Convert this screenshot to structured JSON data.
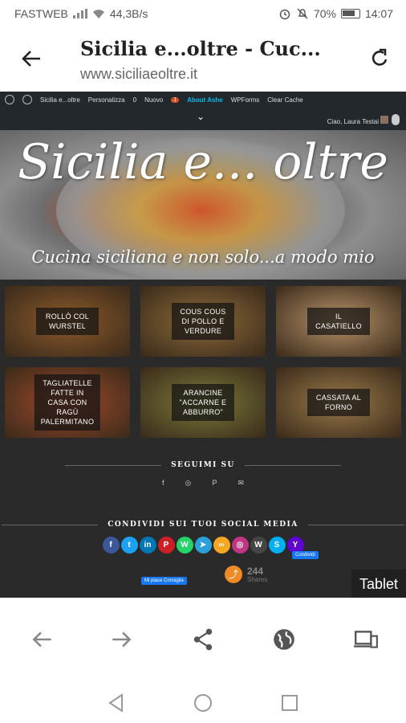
{
  "status_bar": {
    "carrier": "FASTWEB",
    "speed": "44,3B/s",
    "battery": "70%",
    "time": "14:07"
  },
  "browser": {
    "title": "Sicilia e...oltre - Cuc...",
    "url": "www.siciliaeoltre.it"
  },
  "admin_bar": {
    "items": [
      "Sicilia e...oltre",
      "Personalizza",
      "0",
      "Nuovo",
      "1",
      "About Ashe",
      "WPForms",
      "Clear Cache"
    ],
    "greeting": "Ciao, Laura Testai"
  },
  "hero": {
    "title": "Sicilia e... oltre",
    "tagline": "Cucina siciliana e non solo...a modo mio"
  },
  "cards": [
    {
      "label": "ROLLÒ COL WURSTEL",
      "color": "#8b5a2b"
    },
    {
      "label": "COUS COUS DI POLLO E VERDURE",
      "color": "#8c6a3a"
    },
    {
      "label": "IL CASATIELLO",
      "color": "#b8946a"
    },
    {
      "label": "TAGLIATELLE FATTE IN CASA CON RAGÙ PALERMITANO",
      "color": "#a04a2a"
    },
    {
      "label": "ARANCINE \"ACCARNE E ABBURRO\"",
      "color": "#7a7a3a"
    },
    {
      "label": "CASSATA AL FORNO",
      "color": "#9a7a4a"
    }
  ],
  "follow": {
    "title": "SEGUIMI SU",
    "icons": [
      "f",
      "◎",
      "P",
      "✉"
    ]
  },
  "share": {
    "title": "CONDIVIDI SUI TUOI SOCIAL MEDIA",
    "buttons": [
      {
        "glyph": "f",
        "color": "#3b5998"
      },
      {
        "glyph": "t",
        "color": "#1da1f2"
      },
      {
        "glyph": "in",
        "color": "#0077b5"
      },
      {
        "glyph": "P",
        "color": "#cb2027"
      },
      {
        "glyph": "W",
        "color": "#25d366"
      },
      {
        "glyph": "➤",
        "color": "#2aa1da"
      },
      {
        "glyph": "∞",
        "color": "#f5a623"
      },
      {
        "glyph": "◎",
        "color": "#c13584"
      },
      {
        "glyph": "W",
        "color": "#464646"
      },
      {
        "glyph": "S",
        "color": "#00aff0"
      },
      {
        "glyph": "Y",
        "color": "#5f01d1"
      }
    ],
    "fb_condividi": "Condividi",
    "like_bar": "Mi piace  Consiglia",
    "count": "244",
    "count_label": "Shares"
  },
  "tablet_badge": "Tablet"
}
